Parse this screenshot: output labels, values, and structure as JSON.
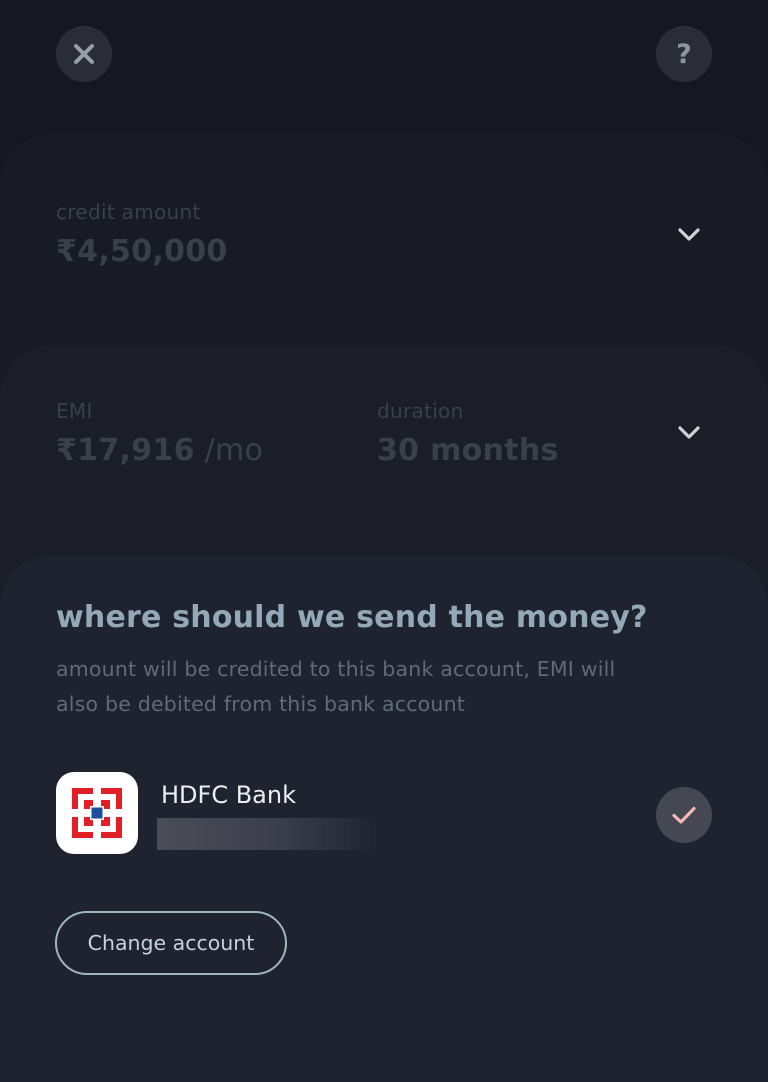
{
  "header": {
    "close_icon": "close-icon",
    "help_icon": "help-icon",
    "help_glyph": "?"
  },
  "credit": {
    "label": "credit amount",
    "value": "₹4,50,000",
    "expand_icon": "chevron-down-icon"
  },
  "emi": {
    "label": "EMI",
    "value": "₹17,916",
    "unit": " /mo",
    "duration_label": "duration",
    "duration_value": "30 months",
    "expand_icon": "chevron-down-icon"
  },
  "bank_section": {
    "title": "where should we send the money?",
    "subtitle": "amount will be credited to this bank account, EMI will also be debited from this bank account",
    "account": {
      "bank_name": "HDFC Bank",
      "logo_icon": "hdfc-logo-icon",
      "selected_icon": "checkmark-icon",
      "selected_color": "#f3b7b7"
    },
    "change_button_label": "Change account"
  },
  "colors": {
    "background": "#151820",
    "card_bank": "#1f2330",
    "title_accent": "#93a9b6",
    "hdfc_red": "#e21f26",
    "hdfc_blue": "#1c4f9c"
  }
}
